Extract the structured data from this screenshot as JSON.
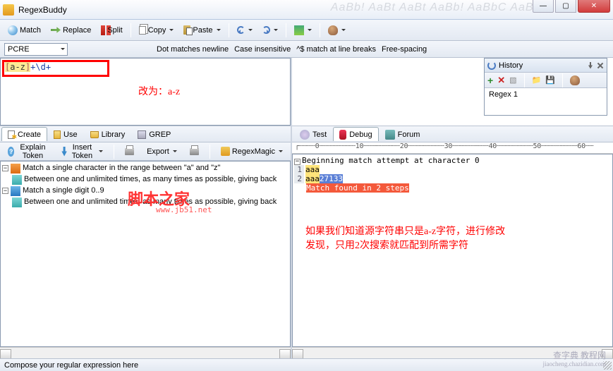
{
  "window": {
    "title": "RegexBuddy",
    "faded_bg": "AaBb! AaBt AaBt AaBb! AaBbC AaBbC"
  },
  "toolbar": {
    "match": "Match",
    "replace": "Replace",
    "split": "Split",
    "copy": "Copy",
    "paste": "Paste"
  },
  "row2": {
    "flavor": "PCRE",
    "opt_dot": "Dot matches newline",
    "opt_case": "Case insensitive",
    "opt_line": "^$ match at line breaks",
    "opt_free": "Free-spacing"
  },
  "regex": {
    "class_open": "[",
    "range": "a-z",
    "class_close": "]",
    "q1": "+",
    "esc": "\\d",
    "q2": "+",
    "annotation": "改为：a-z"
  },
  "tabs_left": {
    "create": "Create",
    "use": "Use",
    "library": "Library",
    "grep": "GREP"
  },
  "subtool": {
    "explain": "Explain Token",
    "insert": "Insert Token",
    "export": "Export",
    "magic": "RegexMagic"
  },
  "tree": {
    "n1": "Match a single character in the range between \"a\" and \"z\"",
    "n1a": "Between one and unlimited times, as many times as possible, giving back",
    "n2": "Match a single digit 0..9",
    "n2a": "Between one and unlimited times, as many times as possible, giving back"
  },
  "watermark": {
    "main": "脚本之家",
    "sub": "www.jb51.net"
  },
  "history": {
    "title": "History",
    "item1": "Regex 1"
  },
  "tabs_right": {
    "test": "Test",
    "debug": "Debug",
    "forum": "Forum"
  },
  "ruler": "┌┄┄┄┄0┄┄┄┄┄┄┄┄┄10┄┄┄┄┄┄┄┄┄20┄┄┄┄┄┄┄┄┄30┄┄┄┄┄┄┄┄┄40┄┄┄┄┄┄┄┄┄50┄┄┄┄┄┄┄┄┄60┄┄",
  "output": {
    "l0": "Beginning match attempt at character 0",
    "g1": "1",
    "l1a": "aaa",
    "g2": "2",
    "l2a": "aaa",
    "l2b": "27133",
    "l3": "Match found in 2 steps",
    "annotation1": "如果我们知道源字符串只是a-z字符，进行修改",
    "annotation2": "发现，只用2次搜索就匹配到所需字符"
  },
  "status": {
    "text": "Compose your regular expression here"
  },
  "footer_wm": {
    "l1": "查字典 教程网",
    "l2": "jiaocheng.chazidian.com"
  }
}
